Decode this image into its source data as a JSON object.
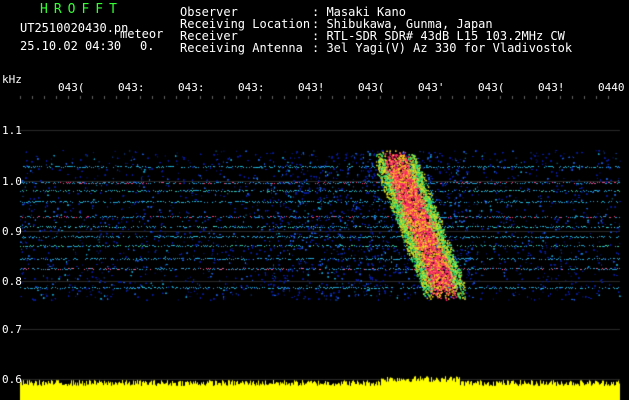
{
  "header": {
    "brand": "HROFFT",
    "filename": "UT2510020430.pn",
    "mode": "meteor",
    "datetime": "25.10.02 04:30",
    "counter": "0.",
    "labels": [
      "Observer",
      "Receiving Location",
      "Receiver",
      "Receiving Antenna"
    ],
    "values": [
      ": Masaki Kano",
      ": Shibukawa, Gunma, Japan",
      ": RTL-SDR SDR# 43dB L15 103.2MHz CW",
      ": 3el Yagi(V) Az 330 for Vladivostok"
    ]
  },
  "x_axis": {
    "ticks": [
      "043(",
      "043:",
      "043:",
      "043:",
      "043!",
      "043(",
      "043'",
      "043(",
      "043!",
      "0440"
    ]
  },
  "y_axis": {
    "unit": "kHz",
    "ticks": [
      "1.1",
      "1.0",
      "0.9",
      "0.8",
      "0.7",
      "0.6"
    ]
  },
  "colors": {
    "background": "#000000",
    "text": "#ffffff",
    "brand": "#33ff33",
    "signal": "#ffff00"
  }
}
